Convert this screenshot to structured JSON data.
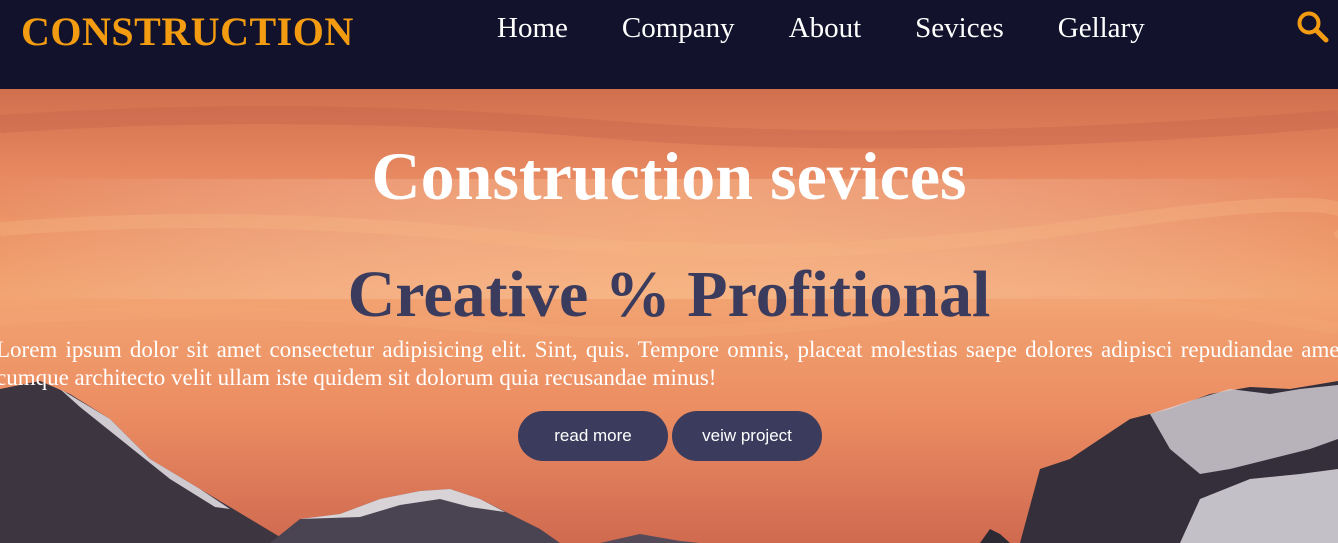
{
  "brand": {
    "logo_text": "CONSTRUCTION",
    "color": "#f39c12"
  },
  "nav": {
    "items": [
      {
        "label": "Home"
      },
      {
        "label": "Company"
      },
      {
        "label": "About"
      },
      {
        "label": "Sevices"
      },
      {
        "label": "Gellary"
      }
    ],
    "search_icon": "search-icon",
    "background": "#12122c"
  },
  "hero": {
    "title": "Construction sevices",
    "subtitle": "Creative % Profitional",
    "text": "Lorem ipsum dolor sit amet consectetur adipisicing elit. Sint, quis. Tempore omnis, placeat molestias saepe dolores adipisci repudiandae amet cumque architecto velit ullam iste quidem sit dolorum quia recusandae minus!",
    "buttons": [
      {
        "label": "read more"
      },
      {
        "label": "veiw project"
      }
    ],
    "accent_color": "#3b3c5d"
  }
}
